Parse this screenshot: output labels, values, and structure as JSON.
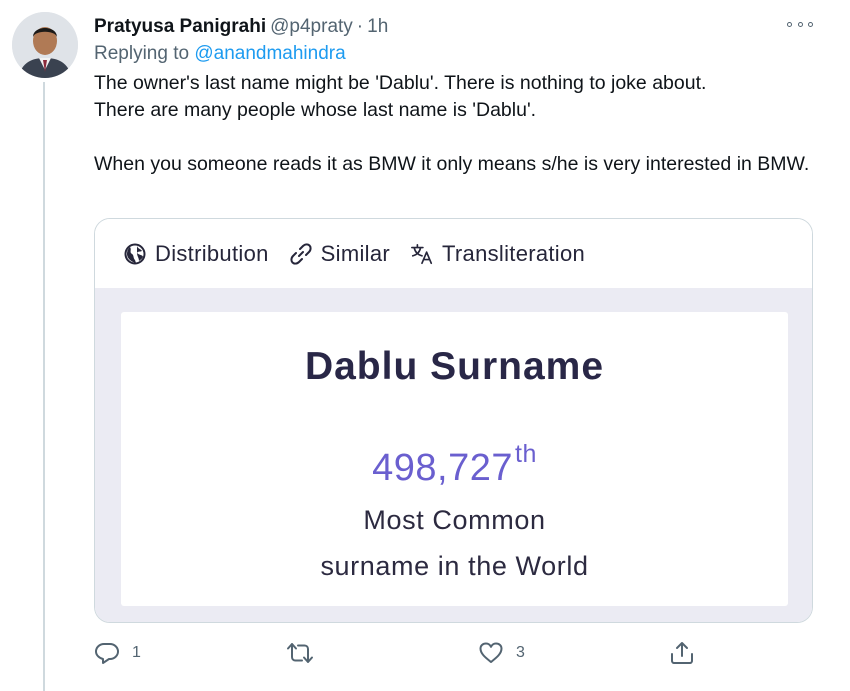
{
  "tweet": {
    "author_name": "Pratyusa Panigrahi",
    "author_handle": "@p4praty",
    "separator": "·",
    "time": "1h",
    "replying_prefix": "Replying to",
    "replying_handle": "@anandmahindra",
    "text_line1": "The owner's last name might be 'Dablu'. There is nothing to joke about.",
    "text_line2": "There are many people whose last name is 'Dablu'.",
    "text_line3": "When you someone reads it as BMW it only means s/he is very interested in BMW.",
    "avatar_icon": "profile-photo",
    "more_icon": "more-options-icon"
  },
  "card": {
    "tabs": [
      {
        "label": "Distribution",
        "icon": "globe-icon"
      },
      {
        "label": "Similar",
        "icon": "link-icon"
      },
      {
        "label": "Transliteration",
        "icon": "translate-icon"
      }
    ],
    "title": "Dablu Surname",
    "rank_number": "498,727",
    "rank_suffix": "th",
    "rank_line1": "Most Common",
    "rank_line2": "surname in the World",
    "accent_color": "#6a5fcf",
    "title_color": "#292747"
  },
  "actions": {
    "reply_count": "1",
    "retweet_count": "",
    "like_count": "3",
    "share_count": ""
  },
  "colors": {
    "link": "#1d9bf0",
    "muted": "#536471",
    "thread_line": "#cfd9de"
  }
}
